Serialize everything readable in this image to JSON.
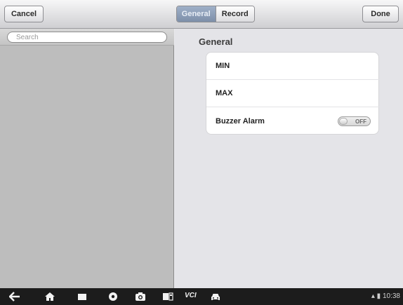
{
  "toolbar": {
    "cancel_label": "Cancel",
    "done_label": "Done",
    "tabs": [
      {
        "label": "General",
        "active": true
      },
      {
        "label": "Record",
        "active": false
      }
    ]
  },
  "sidebar": {
    "search": {
      "placeholder": "Search",
      "value": ""
    }
  },
  "main": {
    "section_title": "General",
    "rows": [
      {
        "label": "MIN"
      },
      {
        "label": "MAX"
      },
      {
        "label": "Buzzer Alarm",
        "toggle": {
          "state": "OFF"
        }
      }
    ]
  },
  "system_bar": {
    "icons": [
      "back-icon",
      "home-icon",
      "recent-apps-icon",
      "browser-icon",
      "camera-icon",
      "display-icon",
      "vci-icon",
      "car-icon"
    ],
    "vci_label": "VCI",
    "time": "10:38",
    "accent": "#7d8fa9"
  }
}
